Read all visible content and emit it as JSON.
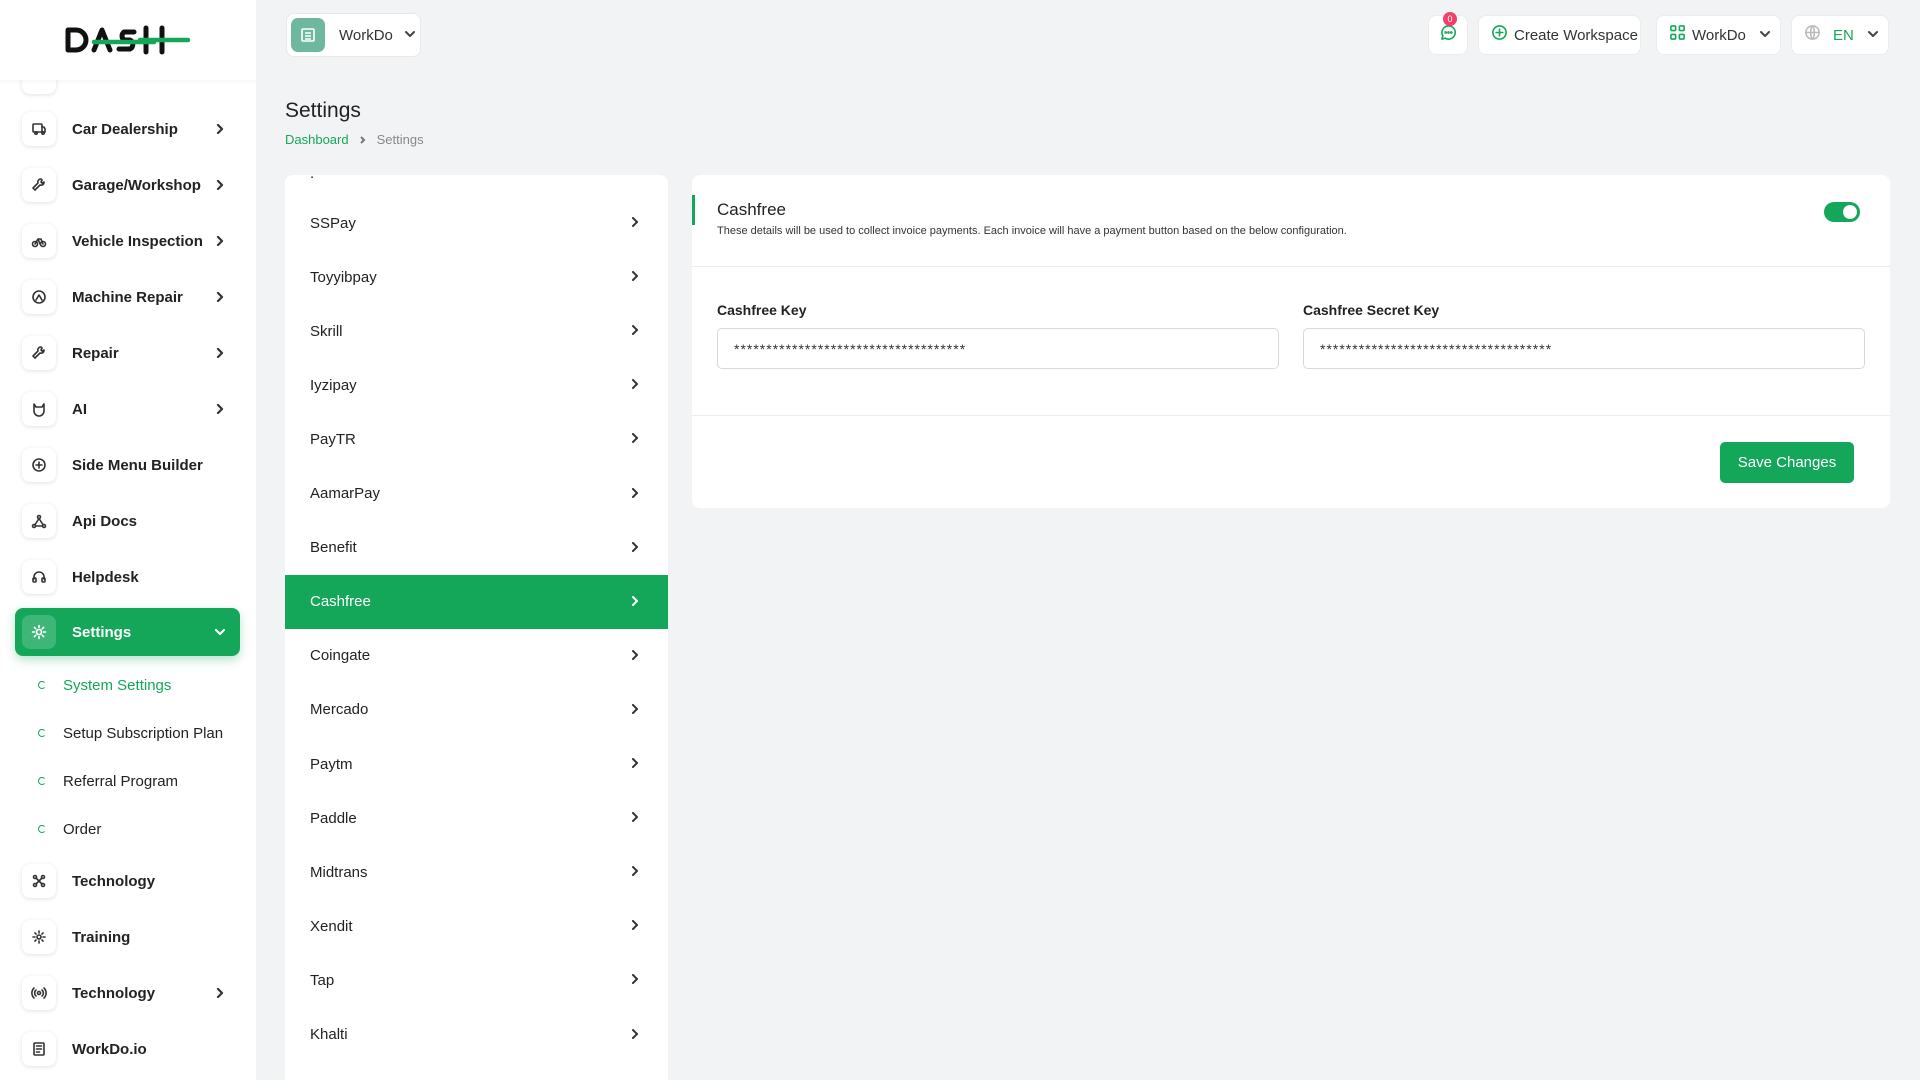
{
  "brand": {
    "logo_text": "DASH"
  },
  "sidebar": {
    "items": [
      {
        "label": "Car Dealership",
        "icon": "car-dealership-icon",
        "chevron": true
      },
      {
        "label": "Garage/Workshop",
        "icon": "wrench-icon",
        "chevron": true
      },
      {
        "label": "Vehicle Inspection",
        "icon": "bike-icon",
        "chevron": true
      },
      {
        "label": "Machine Repair",
        "icon": "machine-icon",
        "chevron": true
      },
      {
        "label": "Repair",
        "icon": "tools-icon",
        "chevron": true
      },
      {
        "label": "AI",
        "icon": "ai-icon",
        "chevron": true
      },
      {
        "label": "Side Menu Builder",
        "icon": "plus-circle-icon",
        "chevron": false
      },
      {
        "label": "Api Docs",
        "icon": "api-icon",
        "chevron": false
      },
      {
        "label": "Helpdesk",
        "icon": "headset-icon",
        "chevron": false
      },
      {
        "label": "Settings",
        "icon": "gear-icon",
        "chevron": true,
        "active": true
      },
      {
        "label": "Technology",
        "icon": "network-icon",
        "chevron": false
      },
      {
        "label": "Training",
        "icon": "training-icon",
        "chevron": false
      },
      {
        "label": "Technology",
        "icon": "broadcast-icon",
        "chevron": true
      },
      {
        "label": "WorkDo.io",
        "icon": "document-icon",
        "chevron": false
      }
    ],
    "settings_sub": [
      {
        "label": "System Settings",
        "active": true
      },
      {
        "label": "Setup Subscription Plan"
      },
      {
        "label": "Referral Program"
      },
      {
        "label": "Order"
      }
    ]
  },
  "header": {
    "workspace_name": "WorkDo",
    "notification_count": "0",
    "create_workspace_label": "Create Workspace",
    "workspace_menu_label": "WorkDo",
    "language_label": "EN"
  },
  "page": {
    "title": "Settings",
    "breadcrumb": {
      "home": "Dashboard",
      "current": "Settings"
    }
  },
  "payment_methods": {
    "items": [
      "SSPay",
      "Toyyibpay",
      "Skrill",
      "Iyzipay",
      "PayTR",
      "AamarPay",
      "Benefit",
      "Cashfree",
      "Coingate",
      "Mercado",
      "Paytm",
      "Paddle",
      "Midtrans",
      "Xendit",
      "Tap",
      "Khalti"
    ],
    "active": "Cashfree"
  },
  "cashfree": {
    "title": "Cashfree",
    "description": "These details will be used to collect invoice payments. Each invoice will have a payment button based on the below configuration.",
    "enabled": true,
    "key_label": "Cashfree Key",
    "key_value": "************************************",
    "secret_label": "Cashfree Secret Key",
    "secret_value": "************************************",
    "save_label": "Save Changes"
  },
  "colors": {
    "accent": "#14a759",
    "badge": "#ef4169",
    "background": "#f2f3f5"
  }
}
